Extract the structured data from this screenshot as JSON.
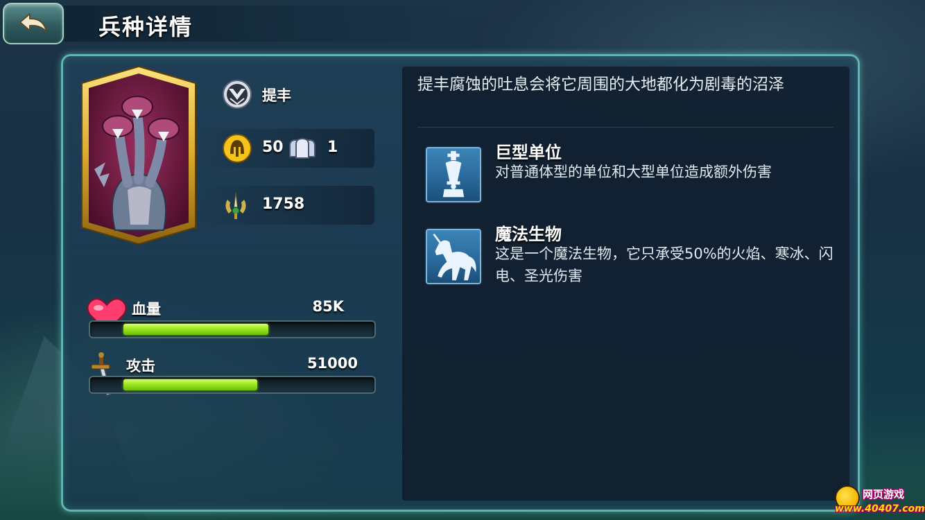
{
  "header": {
    "title": "兵种详情",
    "back_icon": "back-arrow-icon"
  },
  "unit": {
    "name": "提丰",
    "faction_icon": "faction-emblem-icon",
    "portrait": "hydra-three-headed-portrait",
    "cost_icon": "gold-helmet-icon",
    "cost": "50",
    "population_icon": "troop-population-icon",
    "population": "1",
    "power_icon": "sword-crest-icon",
    "power": "1758"
  },
  "stats": [
    {
      "label": "血量",
      "value": "85K",
      "fill": 0.67,
      "icon": "heart-icon"
    },
    {
      "label": "攻击",
      "value": "51000",
      "fill": 0.62,
      "icon": "sword-icon"
    }
  ],
  "description": "提丰腐蚀的吐息会将它周围的大地都化为剧毒的沼泽",
  "traits": [
    {
      "icon": "chess-king-icon",
      "title": "巨型单位",
      "desc": "对普通体型的单位和大型单位造成额外伤害"
    },
    {
      "icon": "unicorn-icon",
      "title": "魔法生物",
      "desc": "这是一个魔法生物，它只承受50%的火焰、寒冰、闪电、圣光伤害"
    }
  ],
  "watermark": {
    "title": "网页游戏",
    "url": "www.40407.com"
  },
  "colors": {
    "bar_fill": "#98e31c",
    "panel_border": "#5fb5b0",
    "portrait_frame": "#d9a92b",
    "trait_icon_bg": "#2a6a9c"
  }
}
